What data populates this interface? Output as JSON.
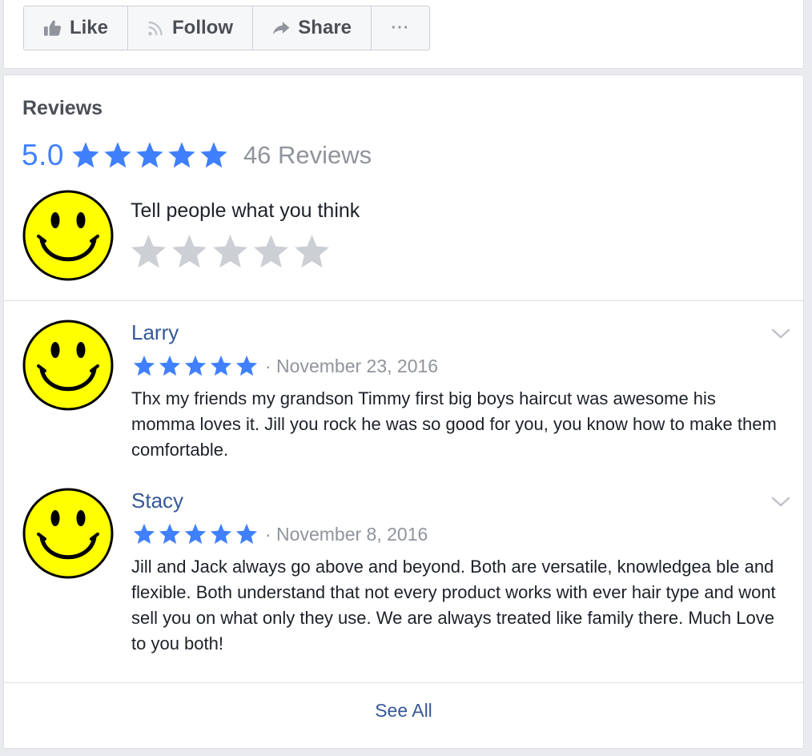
{
  "actions": {
    "like_label": "Like",
    "follow_label": "Follow",
    "share_label": "Share",
    "more_label": "···"
  },
  "reviews": {
    "title": "Reviews",
    "average_rating": "5.0",
    "average_stars": 5,
    "count_label": "46 Reviews",
    "compose_prompt": "Tell people what you think",
    "compose_stars": 0,
    "items": [
      {
        "author": "Larry",
        "stars": 5,
        "date": "· November 23, 2016",
        "text": "Thx my friends my grandson Timmy first big boys haircut was awesome his momma loves it. Jill you rock he was so good for you, you know how to make them comfortable."
      },
      {
        "author": "Stacy",
        "stars": 5,
        "date": "· November 8, 2016",
        "text": "Jill and Jack always go above and beyond. Both are versatile, knowledgea ble and flexible. Both understand that not every product works with ever hair type and wont sell you on what only they use. We are always treated like family there. Much Love to you both!"
      }
    ],
    "see_all_label": "See All"
  },
  "colors": {
    "star_filled": "#4080ff",
    "star_empty": "#ccd0d5",
    "link": "#365899",
    "avatar_face": "#ffff00"
  },
  "icons": {
    "like": "thumbs-up-icon",
    "follow": "rss-feed-icon",
    "share": "share-arrow-icon",
    "more": "more-dots-icon",
    "avatar": "smiley-face-icon",
    "chevron": "chevron-down-icon"
  }
}
